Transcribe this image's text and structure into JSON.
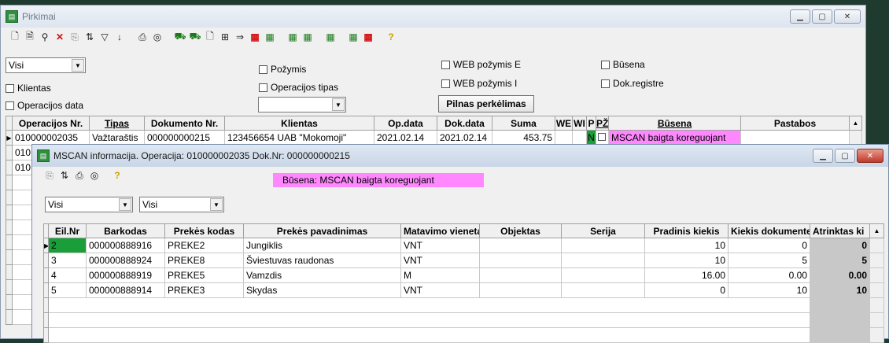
{
  "main_window": {
    "title": "Pirkimai",
    "filters": {
      "visi_select": "Visi",
      "klientas": "Klientas",
      "operacijos_data": "Operacijos data",
      "pozymis": "Požymis",
      "operacijos_tipas": "Operacijos tipas",
      "tipas_select": "",
      "web_pozymis_e": "WEB požymis E",
      "web_pozymis_i": "WEB požymis I",
      "pilnas_button": "Pilnas perkėlimas",
      "busena": "Būsena",
      "dok_registre": "Dok.registre"
    },
    "table": {
      "headers": [
        "Operacijos Nr.",
        "Tipas",
        "Dokumento Nr.",
        "Klientas",
        "Op.data",
        "Dok.data",
        "Suma",
        "WE",
        "WI",
        "P",
        "PŽ",
        "Būsena",
        "Pastabos"
      ],
      "row1": {
        "op_nr": "010000002035",
        "tipas": "Važtaraštis",
        "dok_nr": "000000000215",
        "klientas": "123456654  UAB \"Mokomoji\"",
        "op_data": "2021.02.14",
        "dok_data": "2021.02.14",
        "suma": "453.75",
        "p": "N",
        "busena": "MSCAN baigta koreguojant"
      },
      "row2_prefix": "010",
      "row3_prefix": "010"
    }
  },
  "mscan_window": {
    "title": "MSCAN informacija. Operacija: 010000002035 Dok.Nr: 000000000215",
    "status": "Būsena: MSCAN baigta koreguojant",
    "select1": "Visi",
    "select2": "Visi",
    "headers": [
      "Eil.Nr",
      "Barkodas",
      "Prekės kodas",
      "Prekės pavadinimas",
      "Matavimo vieneta",
      "Objektas",
      "Serija",
      "Pradinis kiekis",
      "Kiekis dokumente",
      "Atrinktas ki"
    ],
    "rows": [
      {
        "eil": "2",
        "barkodas": "000000888916",
        "kodas": "PREKE2",
        "pavadinimas": "Jungiklis",
        "mat": "VNT",
        "pradinis": "10",
        "kiekis": "0",
        "atrinktas": "0"
      },
      {
        "eil": "3",
        "barkodas": "000000888924",
        "kodas": "PREKE8",
        "pavadinimas": "Šviestuvas raudonas",
        "mat": "VNT",
        "pradinis": "10",
        "kiekis": "5",
        "atrinktas": "5"
      },
      {
        "eil": "4",
        "barkodas": "000000888919",
        "kodas": "PREKE5",
        "pavadinimas": "Vamzdis",
        "mat": "M",
        "pradinis": "16.00",
        "kiekis": "0.00",
        "atrinktas": "0.00"
      },
      {
        "eil": "5",
        "barkodas": "000000888914",
        "kodas": "PREKE3",
        "pavadinimas": "Skydas",
        "mat": "VNT",
        "pradinis": "0",
        "kiekis": "10",
        "atrinktas": "10"
      }
    ]
  }
}
